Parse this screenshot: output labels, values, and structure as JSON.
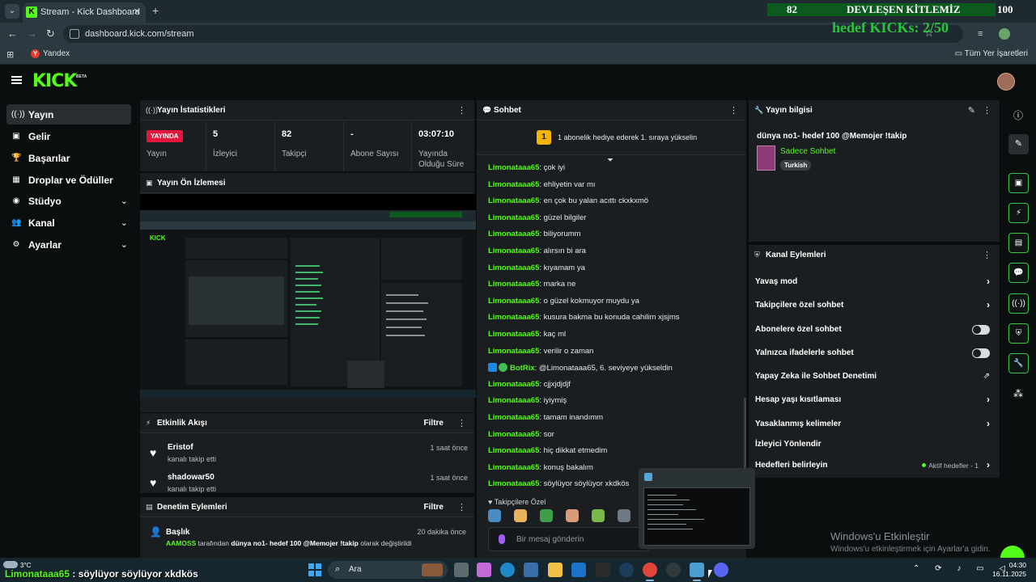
{
  "browser": {
    "tab_title": "Stream - Kick Dashboard",
    "url": "dashboard.kick.com/stream",
    "bookmark_yandex": "Yandex",
    "bookmark_all": "Tüm Yer İşaretleri"
  },
  "overlay": {
    "left_count": "82",
    "title": "DEVLEŞEN KİTLEMİZ",
    "right_count": "100",
    "goal_text": "hedef KICKs: 2/50"
  },
  "header": {
    "logo": "KICK",
    "beta": "BETA"
  },
  "sidebar": {
    "items": [
      {
        "label": "Yayın",
        "icon": "broadcast-icon"
      },
      {
        "label": "Gelir",
        "icon": "wallet-icon"
      },
      {
        "label": "Başarılar",
        "icon": "trophy-icon"
      },
      {
        "label": "Droplar ve Ödüller",
        "icon": "gift-icon"
      },
      {
        "label": "Stüdyo",
        "icon": "studio-icon"
      },
      {
        "label": "Kanal",
        "icon": "users-icon"
      },
      {
        "label": "Ayarlar",
        "icon": "gear-icon"
      }
    ]
  },
  "stats": {
    "title": "Yayın İstatistikleri",
    "live_badge": "YAYINDA",
    "live_label": "Yayın",
    "viewers_value": "5",
    "viewers_label": "İzleyici",
    "followers_value": "82",
    "followers_label": "Takipçi",
    "subs_value": "-",
    "subs_label": "Abone Sayısı",
    "uptime_value": "03:07:10",
    "uptime_label_1": "Yayında",
    "uptime_label_2": "Olduğu Süre"
  },
  "preview": {
    "title": "Yayın Ön İzlemesi"
  },
  "activity": {
    "title": "Etkinlik Akışı",
    "filter": "Filtre",
    "events": [
      {
        "name": "Eristof",
        "sub": "kanalı takip etti",
        "time": "1 saat önce"
      },
      {
        "name": "shadowar50",
        "sub": "kanalı takip etti",
        "time": "1 saat önce"
      }
    ]
  },
  "moderation": {
    "title": "Denetim Eylemleri",
    "filter": "Filtre",
    "item_title": "Başlık",
    "item_time": "20 dakika önce",
    "item_user": "AAMOSS",
    "item_mid": " tarafından ",
    "item_value": "dünya no1- hedef 100 @Memojer !takip",
    "item_tail": " olarak değiştirildi"
  },
  "chat": {
    "title": "Sohbet",
    "notice": "1 abonelik hediye ederek 1. sıraya yükselin",
    "notice_rank": "1",
    "messages": [
      {
        "user": "Limonataaa65",
        "text": ": çok iyi"
      },
      {
        "user": "Limonataaa65",
        "text": ": ehliyetin var mı"
      },
      {
        "user": "Limonataaa65",
        "text": ": en çok bu yalan acıttı ckxkxmö"
      },
      {
        "user": "Limonataaa65",
        "text": ": güzel bilgiler"
      },
      {
        "user": "Limonataaa65",
        "text": ": biliyorumm"
      },
      {
        "user": "Limonataaa65",
        "text": ": alırsın bi ara"
      },
      {
        "user": "Limonataaa65",
        "text": ": kıyamam ya"
      },
      {
        "user": "Limonataaa65",
        "text": ": marka ne"
      },
      {
        "user": "Limonataaa65",
        "text": ": o güzel kokmuyor muydu ya"
      },
      {
        "user": "Limonataaa65",
        "text": ": kusura bakma bu konuda cahilim xjsjms"
      },
      {
        "user": "Limonataaa65",
        "text": ": kaç ml"
      },
      {
        "user": "Limonataaa65",
        "text": ": verilir o zaman"
      },
      {
        "user": "BotRix",
        "text": ": @Limonataaa65, 6. seviyeye yükseldin",
        "bot": true
      },
      {
        "user": "Limonataaa65",
        "text": ": cjjxjdjdjf"
      },
      {
        "user": "Limonataaa65",
        "text": ": iyiymiş"
      },
      {
        "user": "Limonataaa65",
        "text": ": tamam inandımm"
      },
      {
        "user": "Limonataaa65",
        "text": ": sor"
      },
      {
        "user": "Limonataaa65",
        "text": ": hiç dikkat etmedim"
      },
      {
        "user": "Limonataaa65",
        "text": ": konuş bakalım"
      },
      {
        "user": "Limonataaa65",
        "text": ": söylüyor söylüyor xkdkös"
      }
    ],
    "followers_only": "Takipçilere Özel",
    "input_placeholder": "Bir mesaj gönderin"
  },
  "stream_info": {
    "title": "Yayın bilgisi",
    "stream_title": "dünya no1- hedef 100 @Memojer !takip",
    "category": "Sadece Sohbet",
    "tag": "Turkish"
  },
  "channel_actions": {
    "title": "Kanal Eylemleri",
    "items": [
      {
        "label": "Yavaş mod",
        "control": "chevron"
      },
      {
        "label": "Takipçilere özel sohbet",
        "control": "chevron"
      },
      {
        "label": "Abonelere özel sohbet",
        "control": "toggle"
      },
      {
        "label": "Yalnızca ifadelerle sohbet",
        "control": "toggle"
      },
      {
        "label": "Yapay Zeka ile Sohbet Denetimi",
        "control": "external"
      },
      {
        "label": "Hesap yaşı kısıtlaması",
        "control": "chevron"
      },
      {
        "label": "Yasaklanmış kelimeler",
        "control": "chevron"
      },
      {
        "label": "İzleyici Yönlendir",
        "control": "none"
      },
      {
        "label": "Hedefleri belirleyin",
        "control": "chevron"
      }
    ],
    "active_goals": "Aktif hedefler - 1"
  },
  "windows": {
    "activate_title": "Windows'u Etkinleştir",
    "activate_sub": "Windows'u etkinleştirmek için Ayarlar'a gidin.",
    "weather": "3°C",
    "search": "Ara",
    "time": "04:30",
    "date": "16.11.2025"
  },
  "ticker": {
    "user": "Limonataaa65",
    "text": " : söylüyor söylüyor xkdkös"
  },
  "colors": {
    "accent": "#53fc18",
    "live": "#e3163b",
    "panel": "#1b1e20",
    "background": "#0b0e0f"
  }
}
